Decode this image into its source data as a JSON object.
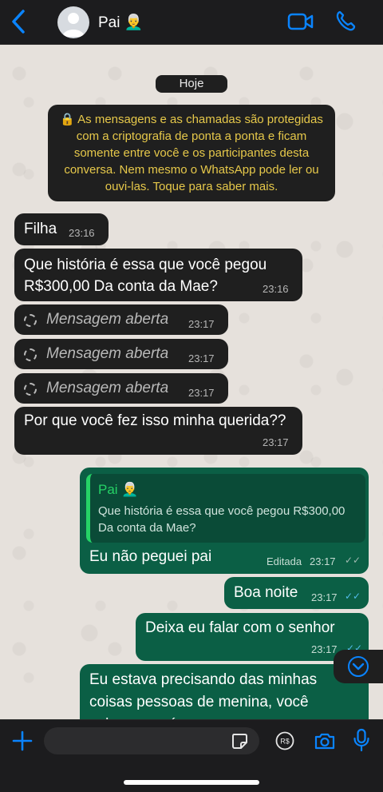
{
  "header": {
    "contact_name": "Pai 👨‍🦳"
  },
  "chat": {
    "date_pill": "Hoje",
    "encryption_notice": "🔒 As mensagens e as chamadas são protegidas com a criptografia de ponta a ponta e ficam somente entre você e os participantes desta conversa. Nem mesmo o WhatsApp pode ler ou ouvi-las. Toque para saber mais.",
    "messages": [
      {
        "text": "Filha",
        "time": "23:16"
      },
      {
        "text": "Que história é essa que você pegou R$300,00 Da conta da Mae?",
        "time": "23:16"
      },
      {
        "text": "Mensagem aberta",
        "time": "23:17"
      },
      {
        "text": "Mensagem aberta",
        "time": "23:17"
      },
      {
        "text": "Mensagem aberta",
        "time": "23:17"
      },
      {
        "text": "Por que você fez isso minha querida??",
        "time": "23:17"
      },
      {
        "quote_name": "Pai 👨‍🦳",
        "quote_text": "Que história é essa que você pegou R$300,00 Da conta da Mae?",
        "text": "Eu não peguei pai",
        "edited": "Editada",
        "time": "23:17"
      },
      {
        "text": "Boa noite",
        "time": "23:17"
      },
      {
        "text": "Deixa eu falar com o senhor",
        "time": "23:17"
      },
      {
        "text": "Eu estava precisando das minhas coisas pessoas de menina, você sabe o que é"
      }
    ]
  },
  "icons": [
    "back-icon",
    "avatar-icon",
    "video-call-icon",
    "phone-call-icon",
    "scroll-down-icon",
    "plus-icon",
    "sticker-icon",
    "payment-icon",
    "camera-icon",
    "microphone-icon"
  ],
  "colors": {
    "accent": "#0a84ff",
    "incoming": "#1f1f1f",
    "outgoing": "#0b5f45",
    "quote_name": "#25d366",
    "notice_text": "#e6c84a"
  }
}
